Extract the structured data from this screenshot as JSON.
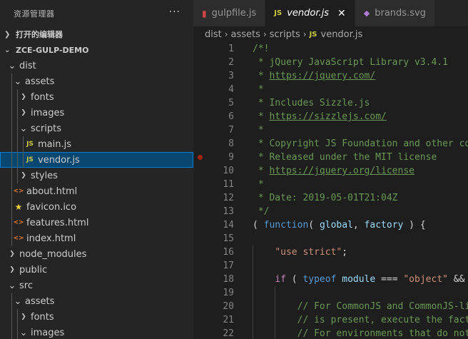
{
  "sidebar": {
    "title": "资源管理器",
    "more_label": "···",
    "open_editors_label": "打开的编辑器",
    "project_name": "ZCE-GULP-DEMO",
    "tree": [
      {
        "label": "dist",
        "type": "folder",
        "open": true,
        "depth": 0
      },
      {
        "label": "assets",
        "type": "folder",
        "open": true,
        "depth": 1
      },
      {
        "label": "fonts",
        "type": "folder",
        "open": false,
        "depth": 2
      },
      {
        "label": "images",
        "type": "folder",
        "open": false,
        "depth": 2
      },
      {
        "label": "scripts",
        "type": "folder",
        "open": true,
        "depth": 2
      },
      {
        "label": "main.js",
        "type": "js",
        "depth": 3
      },
      {
        "label": "vendor.js",
        "type": "js",
        "depth": 3,
        "selected": true
      },
      {
        "label": "styles",
        "type": "folder",
        "open": false,
        "depth": 2
      },
      {
        "label": "about.html",
        "type": "html",
        "depth": 1
      },
      {
        "label": "favicon.ico",
        "type": "ico",
        "depth": 1
      },
      {
        "label": "features.html",
        "type": "html",
        "depth": 1
      },
      {
        "label": "index.html",
        "type": "html",
        "depth": 1
      },
      {
        "label": "node_modules",
        "type": "folder",
        "open": false,
        "depth": 0
      },
      {
        "label": "public",
        "type": "folder",
        "open": false,
        "depth": 0
      },
      {
        "label": "src",
        "type": "folder",
        "open": true,
        "depth": 0
      },
      {
        "label": "assets",
        "type": "folder",
        "open": true,
        "depth": 1
      },
      {
        "label": "fonts",
        "type": "folder",
        "open": false,
        "depth": 2
      },
      {
        "label": "images",
        "type": "folder",
        "open": true,
        "depth": 2
      }
    ]
  },
  "tabs": [
    {
      "label": "gulpfile.js",
      "icon": "gulp-icon",
      "active": false
    },
    {
      "label": "vendor.js",
      "icon": "js-icon",
      "active": true,
      "close": "✕"
    },
    {
      "label": "brands.svg",
      "icon": "svg-icon",
      "active": false
    }
  ],
  "breadcrumb": [
    "dist",
    "assets",
    "scripts",
    "vendor.js"
  ],
  "icons": {
    "js": "JS",
    "html": "<>",
    "svg": "◆",
    "gulp": "▮"
  },
  "colors": {
    "selected_bg": "#094771",
    "accent": "#007fd4",
    "comment": "#6a9955",
    "keyword": "#569cd6",
    "string": "#ce9178",
    "breakpoint": "#a1260d"
  },
  "editor": {
    "breakpoint_line": 9,
    "lines": [
      {
        "n": "1",
        "tokens": [
          [
            "c-comment",
            "/*!"
          ]
        ]
      },
      {
        "n": "2",
        "tokens": [
          [
            "c-comment",
            " * jQuery JavaScript Library v3.4.1"
          ]
        ]
      },
      {
        "n": "3",
        "tokens": [
          [
            "c-comment",
            " * "
          ],
          [
            "c-link",
            "https://jquery.com/"
          ]
        ]
      },
      {
        "n": "4",
        "tokens": [
          [
            "c-comment",
            " *"
          ]
        ]
      },
      {
        "n": "5",
        "tokens": [
          [
            "c-comment",
            " * Includes Sizzle.js"
          ]
        ]
      },
      {
        "n": "6",
        "tokens": [
          [
            "c-comment",
            " * "
          ],
          [
            "c-link",
            "https://sizzlejs.com/"
          ]
        ]
      },
      {
        "n": "7",
        "tokens": [
          [
            "c-comment",
            " *"
          ]
        ]
      },
      {
        "n": "8",
        "tokens": [
          [
            "c-comment",
            " * Copyright JS Foundation and other co"
          ]
        ]
      },
      {
        "n": "9",
        "tokens": [
          [
            "c-comment",
            " * Released under the MIT license"
          ]
        ]
      },
      {
        "n": "10",
        "tokens": [
          [
            "c-comment",
            " * "
          ],
          [
            "c-link",
            "https://jquery.org/license"
          ]
        ]
      },
      {
        "n": "11",
        "tokens": [
          [
            "c-comment",
            " *"
          ]
        ]
      },
      {
        "n": "12",
        "tokens": [
          [
            "c-comment",
            " * Date: 2019-05-01T21:04Z"
          ]
        ]
      },
      {
        "n": "13",
        "tokens": [
          [
            "c-comment",
            " */"
          ]
        ]
      },
      {
        "n": "14",
        "tokens": [
          [
            "c-punc",
            "( "
          ],
          [
            "c-kw",
            "function"
          ],
          [
            "c-punc",
            "( "
          ],
          [
            "c-var",
            "global"
          ],
          [
            "c-punc",
            ", "
          ],
          [
            "c-var",
            "factory"
          ],
          [
            "c-punc",
            " ) {"
          ]
        ]
      },
      {
        "n": "15",
        "tokens": []
      },
      {
        "n": "16",
        "tokens": [
          [
            "c-punc",
            "    "
          ],
          [
            "c-str",
            "\"use strict\""
          ],
          [
            "c-punc",
            ";"
          ]
        ]
      },
      {
        "n": "17",
        "tokens": []
      },
      {
        "n": "18",
        "tokens": [
          [
            "c-punc",
            "    "
          ],
          [
            "c-ctrl",
            "if"
          ],
          [
            "c-punc",
            " ( "
          ],
          [
            "c-kw",
            "typeof"
          ],
          [
            "c-punc",
            " "
          ],
          [
            "c-var",
            "module"
          ],
          [
            "c-punc",
            " === "
          ],
          [
            "c-str",
            "\"object\""
          ],
          [
            "c-punc",
            " && "
          ]
        ]
      },
      {
        "n": "19",
        "tokens": []
      },
      {
        "n": "20",
        "tokens": [
          [
            "c-punc",
            "        "
          ],
          [
            "c-comment",
            "// For CommonJS and CommonJS-lik"
          ]
        ]
      },
      {
        "n": "21",
        "tokens": [
          [
            "c-punc",
            "        "
          ],
          [
            "c-comment",
            "// is present, execute the facto"
          ]
        ]
      },
      {
        "n": "22",
        "tokens": [
          [
            "c-punc",
            "        "
          ],
          [
            "c-comment",
            "// For environments that do not"
          ]
        ]
      }
    ]
  }
}
